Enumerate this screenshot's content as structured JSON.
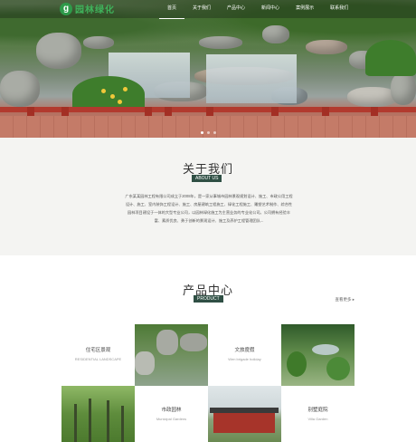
{
  "header": {
    "logo_mark": "g",
    "logo_text": "园林绿化",
    "nav": [
      "首页",
      "关于我们",
      "产品中心",
      "新闻中心",
      "案例展示",
      "联系我们"
    ]
  },
  "about": {
    "title": "关于我们",
    "badge": "ABOUT US",
    "text": "广东某某园林工程有限公司成立于2008年，是一家从事城市园林景观规划设计、施工、市政公用工程设计、施工、室内装饰工程设计、施工、房屋建筑工程施工、绿化工程施工、雕塑艺术制作、综合性园林项目建设于一体的大型专业公司，以园林绿化施工为主营业务的专业化公司。公司拥有经验丰富、素质优良、勇于创新的景观设计、施工及养护工程管理团队..."
  },
  "products": {
    "title": "产品中心",
    "badge": "PRODUCT",
    "more": "查看更多 ▸",
    "cards": [
      {
        "cn": "住宅区景观",
        "en": "RESIDENTIAL LANDSCAPE"
      },
      {
        "cn": "文旅度假",
        "en": "Wen brigade holiday"
      },
      {
        "cn": "市政园林",
        "en": "Municipal Gardens"
      },
      {
        "cn": "别墅庭院",
        "en": "Villa Garden"
      }
    ]
  },
  "colors": {
    "accent": "#2f4f44",
    "logo_green": "#3fb25b",
    "rail_red": "#b23a2e"
  }
}
